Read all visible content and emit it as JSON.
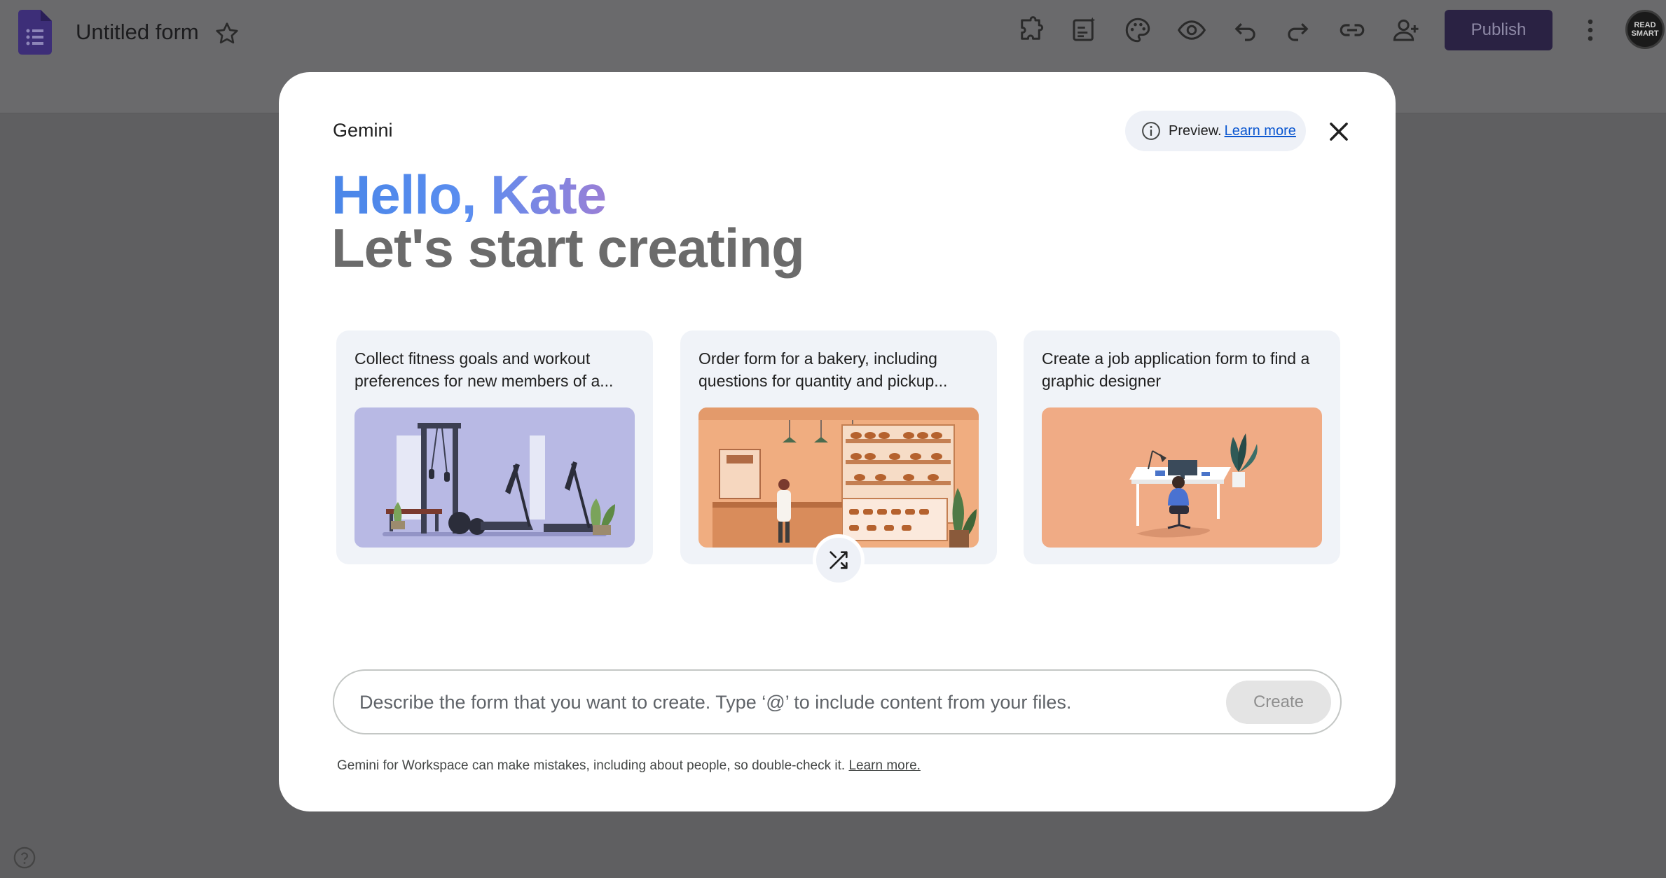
{
  "app": {
    "form_title": "Untitled form",
    "publish_label": "Publish",
    "avatar_text": "READ SMART",
    "toolbar_icons": [
      "extension-icon",
      "customize-icon",
      "palette-icon",
      "preview-eye-icon",
      "undo-icon",
      "redo-icon",
      "link-icon",
      "add-collaborator-icon"
    ]
  },
  "modal": {
    "brand": "Gemini",
    "preview_text": "Preview.",
    "preview_link": "Learn more",
    "greeting": "Hello, Kate",
    "subheading": "Let's start creating",
    "cards": [
      {
        "text": "Collect fitness goals and workout preferences for new members of a...",
        "image": "gym-illustration"
      },
      {
        "text": "Order form for a bakery, including questions for quantity and pickup...",
        "image": "bakery-illustration"
      },
      {
        "text": "Create a job application form to find a graphic designer",
        "image": "designer-desk-illustration"
      }
    ],
    "prompt_placeholder": "Describe the form that you want to create. Type ‘@’ to include content from your files.",
    "create_label": "Create",
    "disclaimer_text": "Gemini for Workspace can make mistakes, including about people, so double-check it.",
    "disclaimer_link": "Learn more."
  },
  "colors": {
    "accent_blue": "#0b57d0",
    "publish_bg": "#2a2243",
    "gradient_start": "#4a86e8",
    "gradient_end": "#9a7fd6"
  }
}
